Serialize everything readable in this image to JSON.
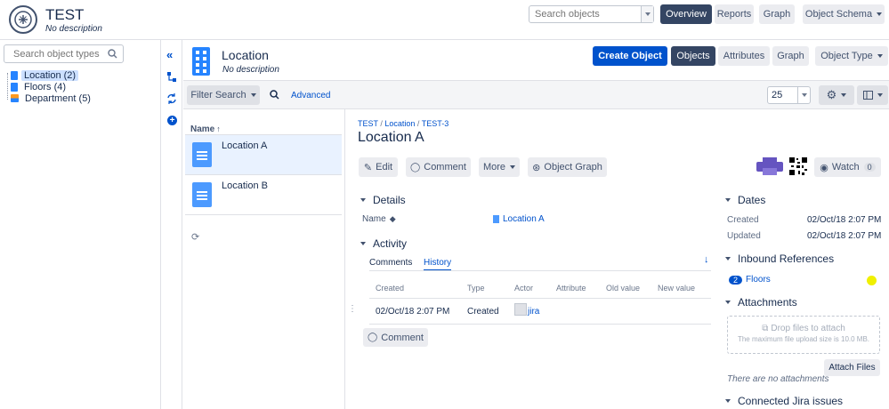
{
  "header": {
    "title": "TEST",
    "subtitle": "No description",
    "search_placeholder": "Search objects",
    "nav": [
      "Overview",
      "Reports",
      "Graph",
      "Object Schema"
    ]
  },
  "sidebar": {
    "search_placeholder": "Search object types",
    "types": [
      {
        "label": "Location (2)",
        "color": "#2684ff"
      },
      {
        "label": "Floors (4)",
        "color": "#2684ff"
      },
      {
        "label": "Department (5)",
        "color": "#ff991f"
      }
    ]
  },
  "type_header": {
    "title": "Location",
    "subtitle": "No description",
    "create_label": "Create Object",
    "tabs": [
      "Objects",
      "Attributes",
      "Graph",
      "Object Type"
    ]
  },
  "filter_bar": {
    "filter_label": "Filter Search",
    "advanced_label": "Advanced",
    "page_size": "25"
  },
  "object_list": {
    "sort_label": "Name",
    "items": [
      "Location A",
      "Location B"
    ]
  },
  "object": {
    "breadcrumb": [
      "TEST",
      "Location",
      "TEST-3"
    ],
    "title": "Location A",
    "actions": {
      "edit": "Edit",
      "comment": "Comment",
      "more": "More",
      "graph": "Object Graph"
    },
    "watch_label": "Watch",
    "watch_count": "0",
    "details": {
      "title": "Details",
      "name_label": "Name",
      "name_value": "Location A"
    },
    "activity": {
      "title": "Activity",
      "tabs": [
        "Comments",
        "History"
      ],
      "columns": [
        "Created",
        "Type",
        "Actor",
        "Attribute",
        "Old value",
        "New value"
      ],
      "rows": [
        {
          "created": "02/Oct/18 2:07 PM",
          "type": "Created",
          "actor": "jira"
        }
      ],
      "comment_button": "Comment"
    }
  },
  "right_panel": {
    "dates": {
      "title": "Dates",
      "created_label": "Created",
      "created_value": "02/Oct/18 2:07 PM",
      "updated_label": "Updated",
      "updated_value": "02/Oct/18 2:07 PM"
    },
    "inbound": {
      "title": "Inbound References",
      "count": "2",
      "label": "Floors"
    },
    "attachments": {
      "title": "Attachments",
      "drop_label": "Drop files to attach",
      "drop_hint": "The maximum file upload size is 10.0 MB.",
      "attach_button": "Attach Files",
      "empty_text": "There are no attachments"
    },
    "jira": {
      "title": "Connected Jira issues"
    }
  },
  "colors": {
    "primary": "#0052cc",
    "dark": "#344563",
    "purple": "#6554c0",
    "highlight": "#e3f2fd"
  }
}
